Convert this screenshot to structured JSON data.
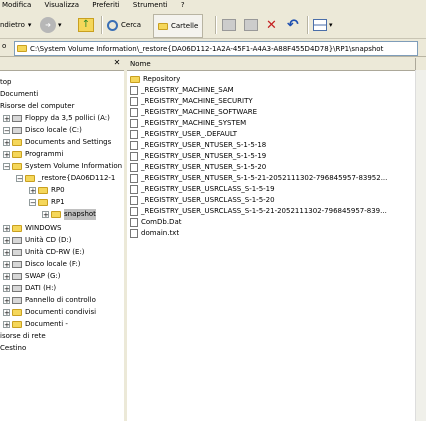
{
  "menu": {
    "items": [
      "Modifica",
      "Visualizza",
      "Preferiti",
      "Strumenti",
      "?"
    ]
  },
  "toolbar": {
    "back_label": "ndietro",
    "search_label": "Cerca",
    "folders_label": "Cartelle"
  },
  "address": {
    "path": "C:\\System Volume Information\\_restore{DA06D112-1A2A-45F1-A4A3-A88F455D4D78}\\RP1\\snapshot"
  },
  "tree": {
    "items": [
      {
        "label": "top",
        "icon": "desktop-icon"
      },
      {
        "label": "Documenti",
        "icon": "folder-icon"
      },
      {
        "label": "Risorse del computer",
        "icon": "computer-icon"
      },
      {
        "label": "Floppy da 3,5 pollici (A:)",
        "icon": "floppy-icon"
      },
      {
        "label": "Disco locale (C:)",
        "icon": "drive-icon"
      },
      {
        "label": "Documents and Settings",
        "icon": "folder-icon"
      },
      {
        "label": "Programmi",
        "icon": "folder-icon"
      },
      {
        "label": "System Volume Information",
        "icon": "folder-icon"
      },
      {
        "label": "_restore{DA06D112-1",
        "icon": "folder-icon"
      },
      {
        "label": "RP0",
        "icon": "folder-icon"
      },
      {
        "label": "RP1",
        "icon": "folder-icon"
      },
      {
        "label": "snapshot",
        "icon": "folder-icon"
      },
      {
        "label": "WINDOWS",
        "icon": "folder-icon"
      },
      {
        "label": "Unità CD (D:)",
        "icon": "cd-icon"
      },
      {
        "label": "Unità CD-RW (E:)",
        "icon": "cd-icon"
      },
      {
        "label": "Disco locale (F:)",
        "icon": "drive-icon"
      },
      {
        "label": "SWAP (G:)",
        "icon": "drive-icon"
      },
      {
        "label": "DATI (H:)",
        "icon": "drive-icon"
      },
      {
        "label": "Pannello di controllo",
        "icon": "control-panel-icon"
      },
      {
        "label": "Documenti condivisi",
        "icon": "folder-icon"
      },
      {
        "label": "Documenti -",
        "icon": "folder-icon"
      },
      {
        "label": "isorse di rete",
        "icon": "network-icon"
      },
      {
        "label": "Cestino",
        "icon": "recycle-bin-icon"
      }
    ]
  },
  "files": {
    "column_name": "Nome",
    "rows": [
      {
        "name": "Repository",
        "icon": "folder-icon"
      },
      {
        "name": "_REGISTRY_MACHINE_SAM",
        "icon": "file-icon"
      },
      {
        "name": "_REGISTRY_MACHINE_SECURITY",
        "icon": "file-icon"
      },
      {
        "name": "_REGISTRY_MACHINE_SOFTWARE",
        "icon": "file-icon"
      },
      {
        "name": "_REGISTRY_MACHINE_SYSTEM",
        "icon": "file-icon"
      },
      {
        "name": "_REGISTRY_USER_.DEFAULT",
        "icon": "file-icon"
      },
      {
        "name": "_REGISTRY_USER_NTUSER_S-1-5-18",
        "icon": "file-icon"
      },
      {
        "name": "_REGISTRY_USER_NTUSER_S-1-5-19",
        "icon": "file-icon"
      },
      {
        "name": "_REGISTRY_USER_NTUSER_S-1-5-20",
        "icon": "file-icon"
      },
      {
        "name": "_REGISTRY_USER_NTUSER_S-1-5-21-2052111302-796845957-83952...",
        "icon": "file-icon"
      },
      {
        "name": "_REGISTRY_USER_USRCLASS_S-1-5-19",
        "icon": "file-icon"
      },
      {
        "name": "_REGISTRY_USER_USRCLASS_S-1-5-20",
        "icon": "file-icon"
      },
      {
        "name": "_REGISTRY_USER_USRCLASS_S-1-5-21-2052111302-796845957-839...",
        "icon": "file-icon"
      },
      {
        "name": "ComDb.Dat",
        "icon": "file-icon"
      },
      {
        "name": "domain.txt",
        "icon": "text-file-icon"
      }
    ]
  }
}
